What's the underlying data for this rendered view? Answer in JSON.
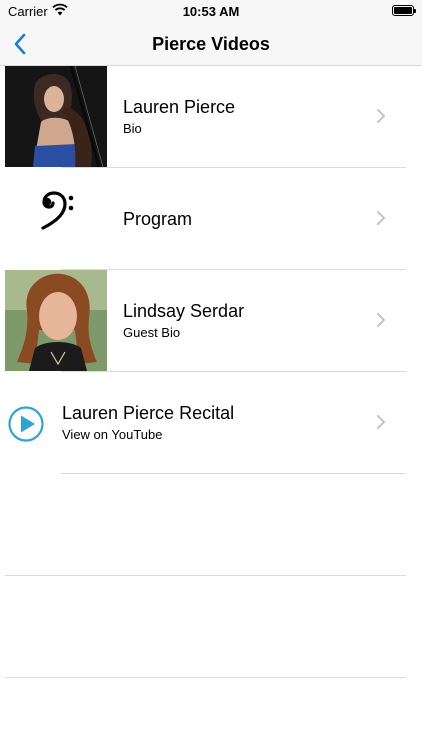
{
  "status": {
    "carrier": "Carrier",
    "time": "10:53 AM"
  },
  "nav": {
    "title": "Pierce Videos",
    "back_icon": "chevron-left-icon"
  },
  "colors": {
    "accent": "#1a7fd1",
    "separator": "#dcdcdc",
    "chevron": "#c4c4c8"
  },
  "rows": [
    {
      "title": "Lauren Pierce",
      "subtitle": "Bio",
      "icon": "photo-lauren-pierce"
    },
    {
      "title": "Program",
      "subtitle": "",
      "icon": "bass-clef-icon"
    },
    {
      "title": "Lindsay Serdar",
      "subtitle": "Guest Bio",
      "icon": "photo-lindsay-serdar"
    },
    {
      "title": "Lauren Pierce Recital",
      "subtitle": "View on YouTube",
      "icon": "play-circle-icon"
    }
  ]
}
